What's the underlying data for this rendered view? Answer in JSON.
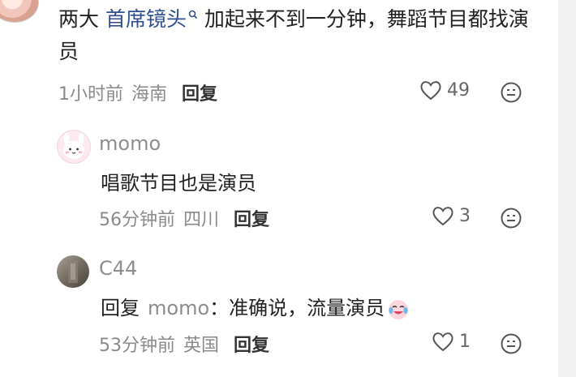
{
  "top_comment": {
    "text_before": "两大 ",
    "link_text": "首席镜头",
    "text_after": "加起来不到一分钟，舞蹈节目都找演员",
    "time": "1小时前",
    "location": "海南",
    "reply_label": "回复",
    "likes": "49"
  },
  "replies": [
    {
      "username": "momo",
      "text": "唱歌节目也是演员",
      "time": "56分钟前",
      "location": "四川",
      "reply_label": "回复",
      "likes": "3",
      "avatar_icon": "cute-bunny-avatar"
    },
    {
      "username": "C44",
      "reply_prefix": "回复",
      "mention": "momo",
      "text": "：准确说，流量演员",
      "emoji": "crying-laughing-emoji",
      "time": "53分钟前",
      "location": "英国",
      "reply_label": "回复",
      "likes": "1",
      "avatar_icon": "photo-avatar"
    }
  ],
  "colors": {
    "link": "#2f4f8f",
    "meta_text": "#8a8a8a",
    "primary_text": "#222222"
  }
}
